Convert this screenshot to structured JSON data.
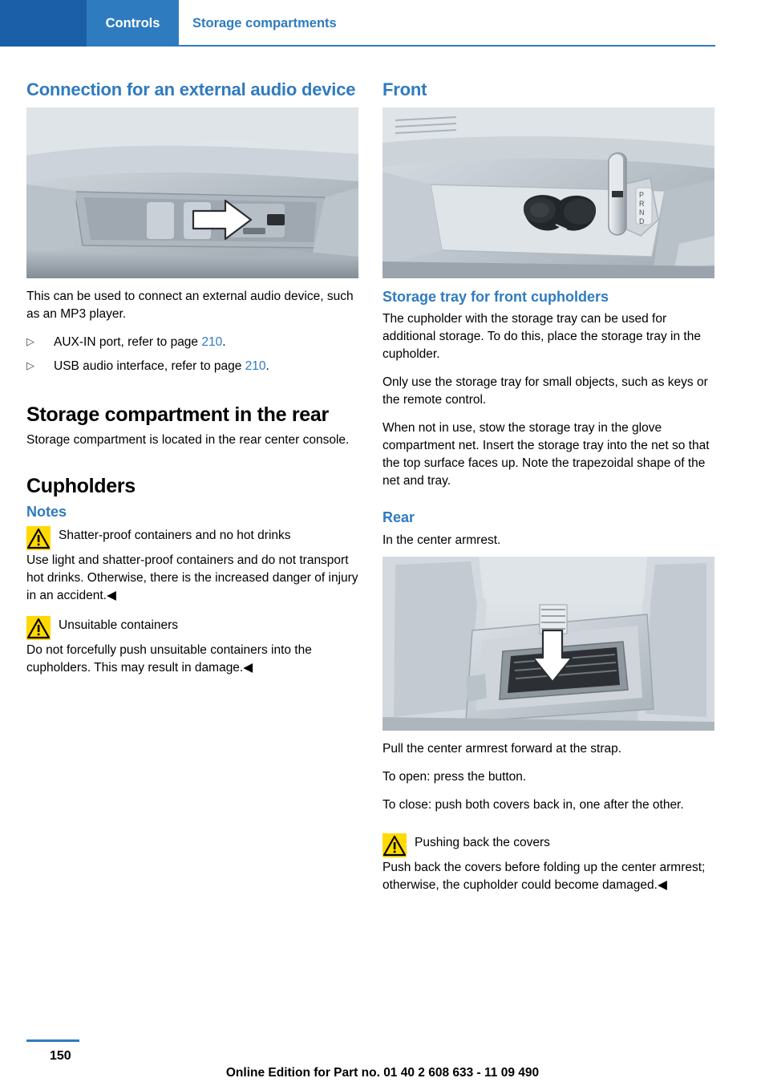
{
  "header": {
    "tab_label": "Controls",
    "section_label": "Storage compartments"
  },
  "left_column": {
    "heading_audio": "Connection for an external audio device",
    "figure_audio_caption": "center-console-storage-compartment-with-aux-usb-ports",
    "intro_text": "This can be used to connect an external audio device, such as an MP3 player.",
    "bullets": [
      {
        "marker": "▷",
        "text_before": "AUX-IN port, refer to page ",
        "link": "210",
        "text_after": "."
      },
      {
        "marker": "▷",
        "text_before": "USB audio interface, refer to page ",
        "link": "210",
        "text_after": "."
      }
    ],
    "heading_storage_rear": "Storage compartment in the rear",
    "storage_rear_text": "Storage compartment is located in the rear center console.",
    "heading_cupholders": "Cupholders",
    "heading_notes": "Notes",
    "warning_1": {
      "title": "Shatter-proof containers and no hot drinks",
      "body": "Use light and shatter-proof containers and do not transport hot drinks. Otherwise, there is the increased danger of injury in an accident.◀"
    },
    "warning_2": {
      "title": "Unsuitable containers",
      "body": "Do not forcefully push unsuitable containers into the cupholders. This may result in damage.◀"
    }
  },
  "right_column": {
    "heading_front": "Front",
    "figure_front_caption": "front-center-console-cupholders-with-gear-selector",
    "heading_storage_tray": "Storage tray for front cupholders",
    "tray_p1": "The cupholder with the storage tray can be used for additional storage. To do this, place the storage tray in the cupholder.",
    "tray_p2": "Only use the storage tray for small objects, such as keys or the remote control.",
    "tray_p3": "When not in use, stow the storage tray in the glove compartment net. Insert the storage tray into the net so that the top surface faces up. Note the trapezoidal shape of the net and tray.",
    "heading_rear": "Rear",
    "rear_p1": "In the center armrest.",
    "figure_rear_caption": "rear-center-armrest-cupholder-with-arrow",
    "rear_p2": "Pull the center armrest forward at the strap.",
    "rear_p3": "To open: press the button.",
    "rear_p4": "To close: push both covers back in, one after the other.",
    "warning_3": {
      "title": "Pushing back the covers",
      "body": "Push back the covers before folding up the center armrest; otherwise, the cupholder could become damaged.◀"
    }
  },
  "footer": {
    "page_number": "150",
    "edition_text": "Online Edition for Part no. 01 40 2 608 633 - 11 09 490"
  },
  "colors": {
    "header_blue_dark": "#1a5fa8",
    "header_blue": "#2f7bbf",
    "link_blue": "#2f7bbf",
    "warning_yellow": "#ffd900"
  }
}
